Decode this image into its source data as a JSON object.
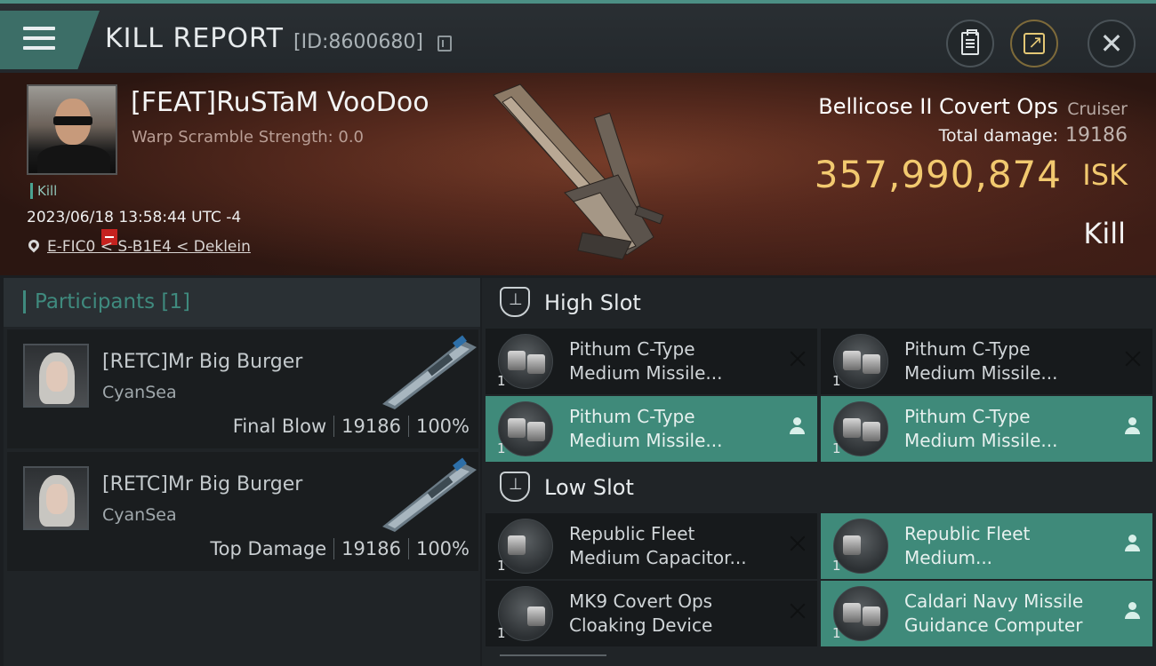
{
  "header": {
    "title": "KILL REPORT",
    "id_text": "[ID:8600680]",
    "menu_icon": "hamburger-menu-icon",
    "buttons": [
      "clipboard-icon",
      "share-icon",
      "close-icon"
    ]
  },
  "victim": {
    "name": "[FEAT]RuSTaM VooDoo",
    "scramble": "Warp Scramble Strength: 0.0",
    "tag": "Kill",
    "datetime": "2023/06/18 13:58:44 UTC -4",
    "location": "E-FIC0 < S-B1E4 < Deklein",
    "ship_name": "Bellicose II Covert Ops",
    "ship_class": "Cruiser",
    "total_damage_label": "Total damage:",
    "total_damage": "19186",
    "isk_value": "357,990,874",
    "isk_unit": "ISK",
    "result": "Kill"
  },
  "participants": {
    "title": "Participants [1]",
    "items": [
      {
        "name": "[RETC]Mr Big Burger",
        "corp": "CyanSea",
        "role": "Final Blow",
        "damage": "19186",
        "percent": "100%"
      },
      {
        "name": "[RETC]Mr Big Burger",
        "corp": "CyanSea",
        "role": "Top Damage",
        "damage": "19186",
        "percent": "100%"
      }
    ]
  },
  "fitting": {
    "high_slot": {
      "title": "High Slot",
      "modules": [
        {
          "qty": "1",
          "line1": "Pithum C-Type",
          "line2": "Medium Missile...",
          "state": "destroyed"
        },
        {
          "qty": "1",
          "line1": "Pithum C-Type",
          "line2": "Medium Missile...",
          "state": "destroyed"
        },
        {
          "qty": "1",
          "line1": "Pithum C-Type",
          "line2": "Medium Missile...",
          "state": "dropped"
        },
        {
          "qty": "1",
          "line1": "Pithum C-Type",
          "line2": "Medium Missile...",
          "state": "dropped"
        }
      ]
    },
    "low_slot": {
      "title": "Low Slot",
      "modules": [
        {
          "qty": "1",
          "line1": "Republic Fleet",
          "line2": "Medium Capacitor...",
          "state": "destroyed"
        },
        {
          "qty": "1",
          "line1": "Republic Fleet",
          "line2": "Medium...",
          "state": "dropped"
        },
        {
          "qty": "1",
          "line1": "MK9 Covert Ops",
          "line2": "Cloaking Device",
          "state": "destroyed"
        },
        {
          "qty": "1",
          "line1": "Caldari Navy Missile",
          "line2": "Guidance Computer",
          "state": "dropped"
        }
      ]
    }
  },
  "colors": {
    "accent_teal": "#3f8a7a",
    "isk_gold": "#f2c96f",
    "security_red": "#c5221f"
  }
}
